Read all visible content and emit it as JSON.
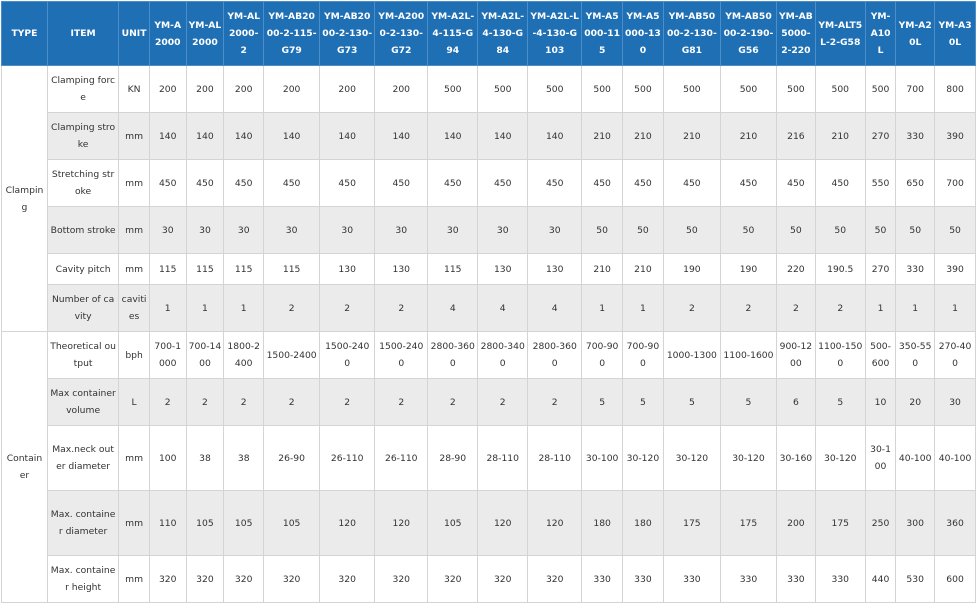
{
  "header": {
    "type": "TYPE",
    "item": "ITEM",
    "unit": "UNIT",
    "models": [
      "YM-A2000",
      "YM-AL2000",
      "YM-AL2000-2",
      "YM-AB2000-2-115-G79",
      "YM-AB2000-2-130-G73",
      "YM-A2000-2-130-G72",
      "YM-A2L-4-115-G94",
      "YM-A2L-4-130-G84",
      "YM-A2L-L-4-130-G103",
      "YM-A5000-115",
      "YM-A5000-130",
      "YM-AB5000-2-130-G81",
      "YM-AB5000-2-190-G56",
      "YM-AB5000-2-220",
      "YM-ALT5L-2-G58",
      "YM-A10L",
      "YM-A20L",
      "YM-A30L"
    ]
  },
  "groups": [
    {
      "label": "Clamping",
      "rows": [
        {
          "item": "Clamping force",
          "unit": "KN",
          "values": [
            "200",
            "200",
            "200",
            "200",
            "200",
            "200",
            "500",
            "500",
            "500",
            "500",
            "500",
            "500",
            "500",
            "500",
            "500",
            "500",
            "700",
            "800"
          ]
        },
        {
          "item": "Clamping stroke",
          "unit": "mm",
          "values": [
            "140",
            "140",
            "140",
            "140",
            "140",
            "140",
            "140",
            "140",
            "140",
            "210",
            "210",
            "210",
            "210",
            "216",
            "210",
            "270",
            "330",
            "390"
          ]
        },
        {
          "item": "Stretching stroke",
          "unit": "mm",
          "values": [
            "450",
            "450",
            "450",
            "450",
            "450",
            "450",
            "450",
            "450",
            "450",
            "450",
            "450",
            "450",
            "450",
            "450",
            "450",
            "550",
            "650",
            "700"
          ]
        },
        {
          "item": "Bottom stroke",
          "unit": "mm",
          "values": [
            "30",
            "30",
            "30",
            "30",
            "30",
            "30",
            "30",
            "30",
            "30",
            "50",
            "50",
            "50",
            "50",
            "50",
            "50",
            "50",
            "50",
            "50"
          ]
        },
        {
          "item": "Cavity pitch",
          "unit": "mm",
          "values": [
            "115",
            "115",
            "115",
            "115",
            "130",
            "130",
            "115",
            "130",
            "130",
            "210",
            "210",
            "190",
            "190",
            "220",
            "190.5",
            "270",
            "330",
            "390"
          ]
        },
        {
          "item": "Number of cavity",
          "unit": "cavities",
          "values": [
            "1",
            "1",
            "1",
            "2",
            "2",
            "2",
            "4",
            "4",
            "4",
            "1",
            "1",
            "2",
            "2",
            "2",
            "2",
            "1",
            "1",
            "1"
          ]
        }
      ]
    },
    {
      "label": "Container",
      "rows": [
        {
          "item": "Theoretical output",
          "unit": "bph",
          "values": [
            "700-1000",
            "700-1400",
            "1800-2400",
            "1500-2400",
            "1500-2400",
            "1500-2400",
            "2800-3600",
            "2800-3400",
            "2800-3600",
            "700-900",
            "700-900",
            "1000-1300",
            "1100-1600",
            "900-1200",
            "1100-1500",
            "500-600",
            "350-550",
            "270-400"
          ]
        },
        {
          "item": "Max container volume",
          "unit": "L",
          "values": [
            "2",
            "2",
            "2",
            "2",
            "2",
            "2",
            "2",
            "2",
            "2",
            "5",
            "5",
            "5",
            "5",
            "6",
            "5",
            "10",
            "20",
            "30"
          ]
        },
        {
          "item": "Max.neck outer diameter",
          "unit": "mm",
          "values": [
            "100",
            "38",
            "38",
            "26-90",
            "26-110",
            "26-110",
            "28-90",
            "28-110",
            "28-110",
            "30-100",
            "30-120",
            "30-120",
            "30-120",
            "30-160",
            "30-120",
            "30-100",
            "40-100",
            "40-100"
          ]
        },
        {
          "item": "Max. container diameter",
          "unit": "mm",
          "values": [
            "110",
            "105",
            "105",
            "105",
            "120",
            "120",
            "105",
            "120",
            "120",
            "180",
            "180",
            "175",
            "175",
            "200",
            "175",
            "250",
            "300",
            "360"
          ]
        },
        {
          "item": "Max. container height",
          "unit": "mm",
          "values": [
            "320",
            "320",
            "320",
            "320",
            "320",
            "320",
            "320",
            "320",
            "320",
            "330",
            "330",
            "330",
            "330",
            "330",
            "330",
            "440",
            "530",
            "600"
          ]
        }
      ]
    }
  ]
}
